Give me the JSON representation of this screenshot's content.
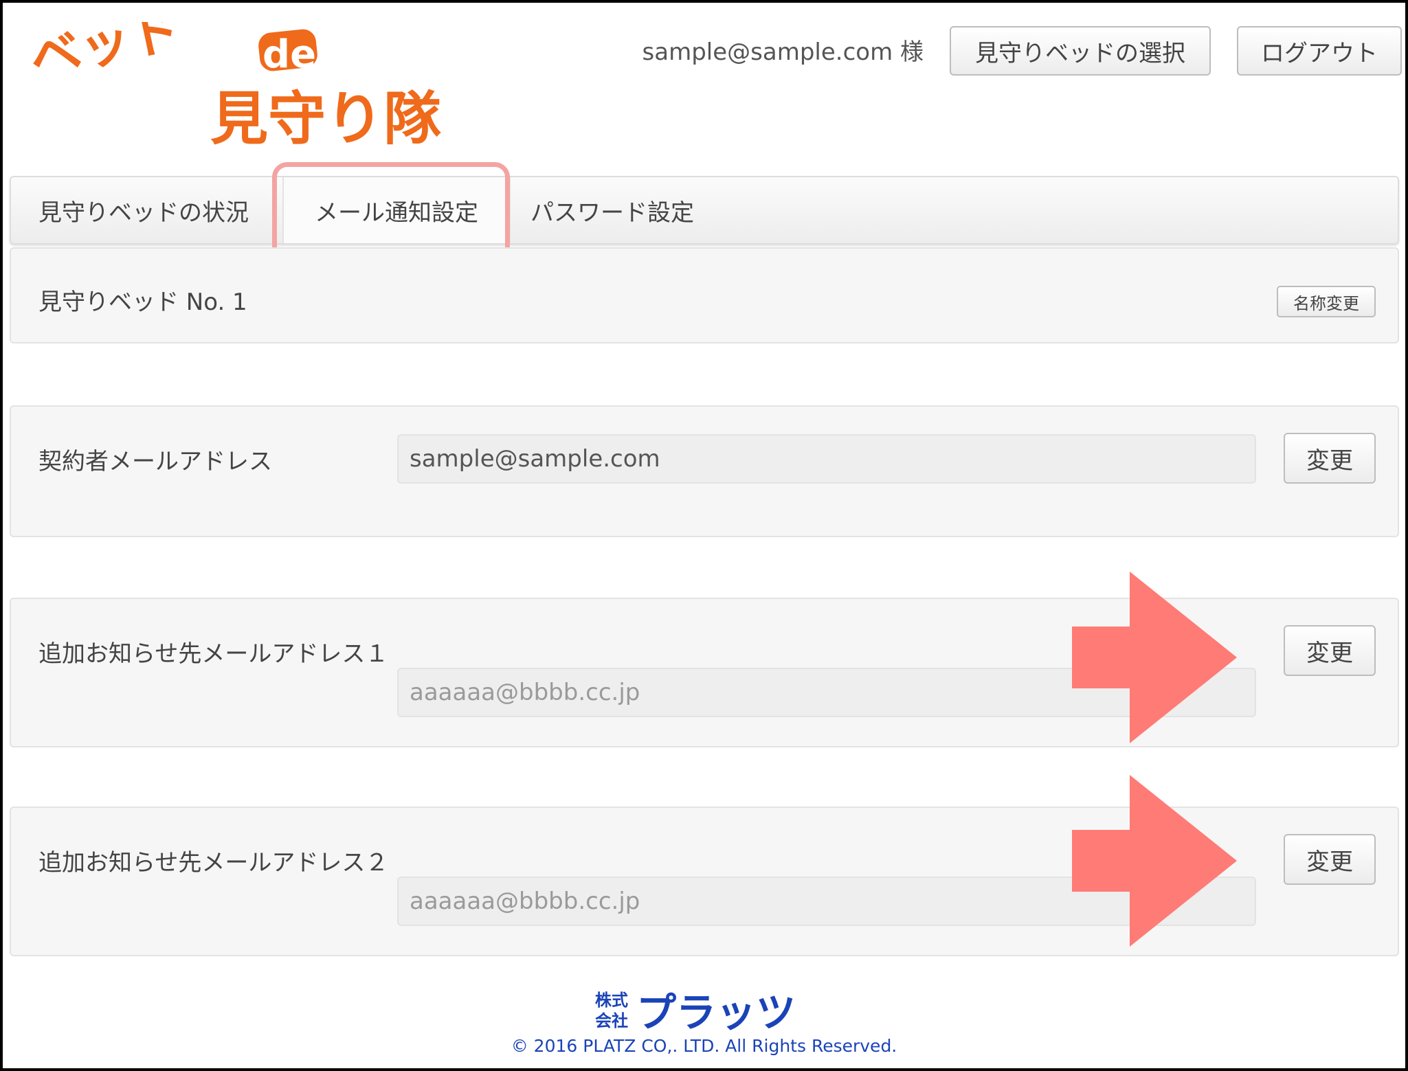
{
  "colors": {
    "brand_orange": "#ef6a1b",
    "highlight_pink": "#f4a3a3",
    "arrow_red": "#ff7b76",
    "footer_blue": "#1a43b8"
  },
  "logo": {
    "line1_text": "ベッド",
    "line1_suffix": "de",
    "line2_text": "見守り隊"
  },
  "header": {
    "user_label": "sample@sample.com 様",
    "select_bed_label": "見守りベッドの選択",
    "logout_label": "ログアウト"
  },
  "tabs": [
    {
      "label": "見守りベッドの状況",
      "active": false
    },
    {
      "label": "メール通知設定",
      "active": true
    },
    {
      "label": "パスワード設定",
      "active": false
    }
  ],
  "bed": {
    "title": "見守りベッド No. 1",
    "rename_label": "名称変更"
  },
  "contract_email": {
    "label": "契約者メールアドレス",
    "value": "sample@sample.com",
    "change_label": "変更"
  },
  "extra_email_1": {
    "label": "追加お知らせ先メールアドレス１",
    "value": "aaaaaa@bbbb.cc.jp",
    "change_label": "変更"
  },
  "extra_email_2": {
    "label": "追加お知らせ先メールアドレス２",
    "value": "aaaaaa@bbbb.cc.jp",
    "change_label": "変更"
  },
  "footer": {
    "company_prefix_top": "株式",
    "company_prefix_bottom": "会社",
    "company_name": "プラッツ",
    "copyright": "© 2016 PLATZ CO,. LTD. All Rights Reserved."
  },
  "icons": {
    "arrow": "right-arrow-icon"
  }
}
